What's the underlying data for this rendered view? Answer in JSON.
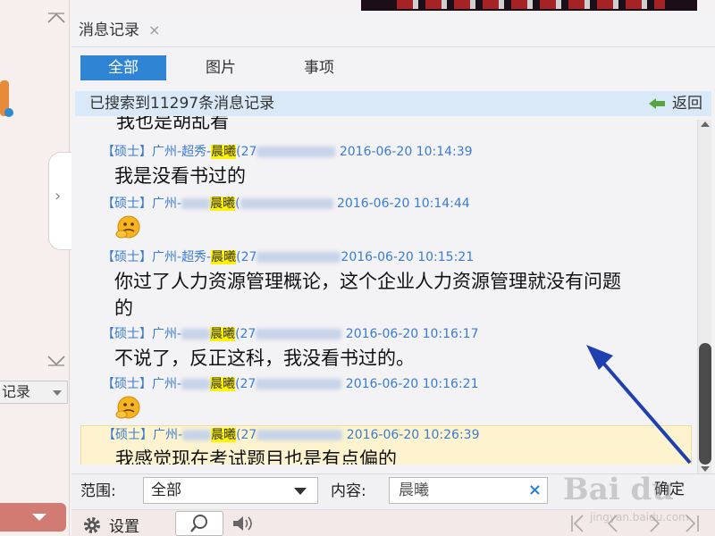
{
  "left_panel": {
    "history_select_label": "记录"
  },
  "header": {
    "tab_title": "消息记录",
    "tab_close_glyph": "×"
  },
  "filter_tabs": [
    {
      "label": "全部",
      "active": true
    },
    {
      "label": "图片",
      "active": false
    },
    {
      "label": "事项",
      "active": false
    }
  ],
  "search_info": {
    "result_text": "已搜索到11297条消息记录",
    "back_label": "返回"
  },
  "messages": {
    "cut_text": "我也是胡乱看",
    "items": [
      {
        "tag": "【硕士】",
        "group": "广州-",
        "group2": "超秀-",
        "name": "晨曦",
        "suffix": "(27",
        "time": "2016-06-20 10:14:39",
        "text": "我是没看书过的",
        "emoji": false,
        "highlighted": false
      },
      {
        "tag": "【硕士】",
        "group": "广州-",
        "group2": "",
        "name": "晨曦",
        "suffix": "(",
        "time": "2016-06-20 10:14:44",
        "text": "",
        "emoji": true,
        "highlighted": false
      },
      {
        "tag": "【硕士】",
        "group": "广州-",
        "group2": "超秀-",
        "name": "晨曦",
        "suffix": "(27",
        "time": "2016-06-20 10:15:21",
        "text": "你过了人力资源管理概论，这个企业人力资源管理就没有问题的",
        "emoji": false,
        "highlighted": false
      },
      {
        "tag": "【硕士】",
        "group": "广州-",
        "group2": "",
        "name": "晨曦",
        "suffix": "(27",
        "time": "2016-06-20 10:16:17",
        "text": "不说了，反正这科，我没看书过的。",
        "emoji": false,
        "highlighted": false
      },
      {
        "tag": "【硕士】",
        "group": "广州-",
        "group2": "",
        "name": "晨曦",
        "suffix": "(27",
        "time": "2016-06-20 10:16:21",
        "text": "",
        "emoji": true,
        "highlighted": false
      },
      {
        "tag": "【硕士】",
        "group": "广州-",
        "group2": "",
        "name": "晨曦",
        "suffix": "(27",
        "time": "2016-06-20 10:26:39",
        "text": "我感觉现在考试题目也是有点偏的",
        "emoji": false,
        "highlighted": true
      }
    ]
  },
  "search_footer": {
    "scope_label": "范围:",
    "scope_value": "全部",
    "content_label": "内容:",
    "content_value": "晨曦",
    "clear_glyph": "×",
    "confirm_label": "确定"
  },
  "bottom_toolbar": {
    "settings_label": "设置"
  },
  "watermark": {
    "brand": "Bai du",
    "domain": "jingyan.baidu.com"
  },
  "colors": {
    "accent": "#2f84d4",
    "sender_blue": "#3a7cd4",
    "name_highlight": "#fff200",
    "annotation_arrow": "#1e40b0"
  }
}
